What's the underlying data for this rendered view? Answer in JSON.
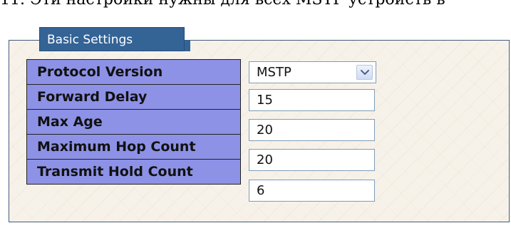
{
  "caption": "11. Эти настройки нужны для всех MSTP устройств в",
  "panel": {
    "title": "Basic Settings"
  },
  "settings": {
    "protocol_version": {
      "label": "Protocol Version",
      "value": "MSTP"
    },
    "forward_delay": {
      "label": "Forward Delay",
      "value": "15"
    },
    "max_age": {
      "label": "Max Age",
      "value": "20"
    },
    "maximum_hop_count": {
      "label": "Maximum Hop Count",
      "value": "20"
    },
    "transmit_hold_count": {
      "label": "Transmit Hold Count",
      "value": "6"
    }
  },
  "icons": {
    "select_arrow": "chevron-down-icon"
  },
  "colors": {
    "tab": "#346396",
    "label_cell": "#8d92e6",
    "field_border": "#7f9db9"
  }
}
